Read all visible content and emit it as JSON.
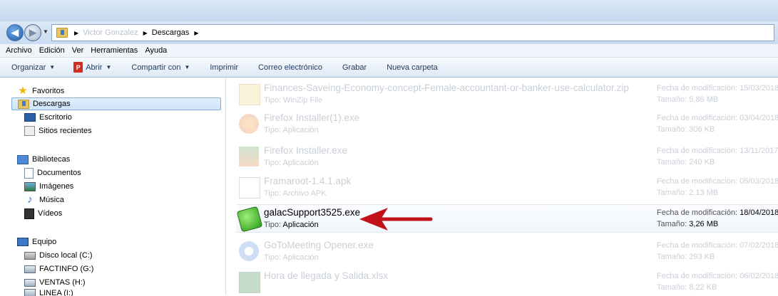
{
  "address": {
    "crumbs": [
      "Victor Gonzalez",
      "Descargas"
    ]
  },
  "menu": [
    "Archivo",
    "Edición",
    "Ver",
    "Herramientas",
    "Ayuda"
  ],
  "toolbar": {
    "organize": "Organizar",
    "open": "Abrir",
    "open_icon": "pdf-icon",
    "share": "Compartir con",
    "print": "Imprimir",
    "email": "Correo electrónico",
    "burn": "Grabar",
    "new_folder": "Nueva carpeta"
  },
  "sidebar": {
    "favorites": "Favoritos",
    "downloads": "Descargas",
    "desktop": "Escritorio",
    "recent": "Sitios recientes",
    "libraries": "Bibliotecas",
    "documents": "Documentos",
    "images": "Imágenes",
    "music": "Música",
    "videos": "Vídeos",
    "computer": "Equipo",
    "local_disk": "Disco local (C:)",
    "factinfo": "FACTINFO (G:)",
    "ventas": "VENTAS (H:)",
    "partial": "LINEA (I:)"
  },
  "labels": {
    "type": "Tipo:",
    "date": "Fecha de modificación:",
    "size": "Tamaño:"
  },
  "files": [
    {
      "name": "Finances-Saveing-Economy-concept-Female-accountant-or-banker-use-calculator.zip",
      "type": "WinZip File",
      "date": "15/03/2018",
      "size": "5,86 MB",
      "icon": "zip-icon"
    },
    {
      "name": "Firefox Installer(1).exe",
      "type": "Aplicación",
      "date": "03/04/2018",
      "size": "306 KB",
      "icon": "firefox-icon"
    },
    {
      "name": "Firefox Installer.exe",
      "type": "Aplicación",
      "date": "13/11/2017",
      "size": "240 KB",
      "icon": "firefox-installer-icon"
    },
    {
      "name": "Framaroot-1.4.1.apk",
      "type": "Archivo APK",
      "date": "05/03/2018",
      "size": "2,13 MB",
      "icon": "apk-file-icon"
    },
    {
      "name": "galacSupport3525.exe",
      "type": "Aplicación",
      "date": "18/04/2018",
      "size": "3,26 MB",
      "icon": "galac-support-icon"
    },
    {
      "name": "GoToMeeting Opener.exe",
      "type": "Aplicación",
      "date": "07/02/2018",
      "size": "293 KB",
      "icon": "gotomeeting-icon"
    },
    {
      "name": "Hora de llegada y Salida.xlsx",
      "type": "",
      "date": "06/02/2018",
      "size": "8,22 KB",
      "icon": "excel-icon"
    }
  ],
  "colors": {
    "arrow": "#c1121c",
    "dim_text": "#c9cfd6"
  }
}
